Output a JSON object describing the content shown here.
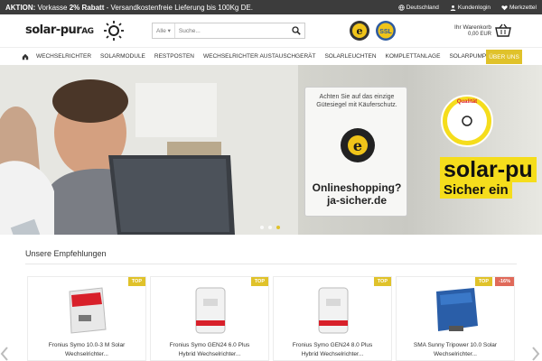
{
  "topbar": {
    "promo_lead": "AKTION: ",
    "promo_a": "Vorkasse ",
    "promo_bold": "2% Rabatt",
    "promo_b": " - Versandkostenfreie Lieferung bis 100Kg DE.",
    "country": "Deutschland",
    "login": "Kundenlogin",
    "wishlist": "Merkzettel"
  },
  "header": {
    "logo_main": "solar-pur",
    "logo_suffix": "AG",
    "search_category": "Alle",
    "search_placeholder": "Suche...",
    "badge_ssl": "SSL",
    "cart_label": "Ihr Warenkorb",
    "cart_total": "0,00 EUR"
  },
  "nav": {
    "items": [
      "WECHSELRICHTER",
      "SOLARMODULE",
      "RESTPOSTEN",
      "WECHSELRICHTER AUSTAUSCHGERÄT",
      "SOLARLEUCHTEN",
      "KOMPLETTANLAGE",
      "SOLARPUMPEN"
    ],
    "sale": "ÜBER UNS"
  },
  "hero": {
    "trust_header": "Achten Sie auf das einzige Gütesiegel mit Käuferschutz.",
    "trust_line1": "Onlineshopping?",
    "trust_line2": "ja-sicher.de",
    "title1": "solar-pu",
    "title2": "Sicher ein",
    "quality_word": "Qualität"
  },
  "recommendations": {
    "title": "Unsere Empfehlungen",
    "products": [
      {
        "name1": "Fronius Symo 10.0-3 M Solar",
        "name2": "Wechselrichter...",
        "tag": "TOP",
        "discount": ""
      },
      {
        "name1": "Fronius Symo GEN24 6.0 Plus",
        "name2": "Hybrid Wechselrichter...",
        "tag": "TOP",
        "discount": ""
      },
      {
        "name1": "Fronius Symo GEN24 8.0 Plus",
        "name2": "Hybrid Wechselrichter...",
        "tag": "TOP",
        "discount": ""
      },
      {
        "name1": "SMA Sunny Tripower 10.0 Solar",
        "name2": "Wechselrichter...",
        "tag": "TOP",
        "discount": "-16%"
      }
    ]
  },
  "colors": {
    "accent": "#e0c22a",
    "topbar": "#3c3c3c",
    "discount": "#e06a5a"
  }
}
